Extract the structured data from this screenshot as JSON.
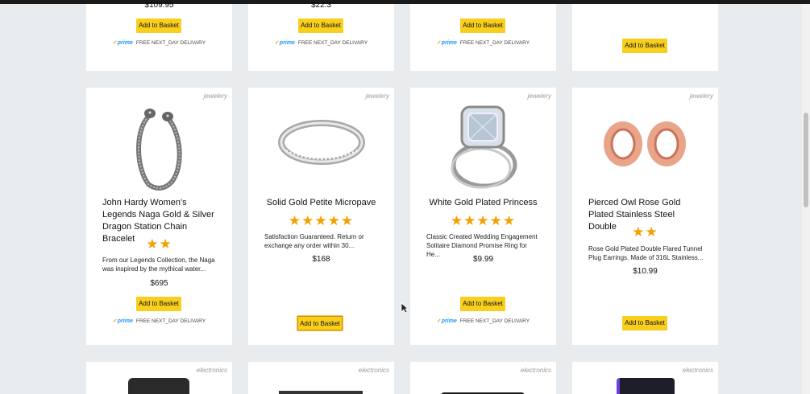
{
  "top_row": [
    {
      "price": "$109.95",
      "button": "Add to Basket",
      "prime": "prime",
      "delivery": "FREE NEXT_DAY DELIVARY"
    },
    {
      "price": "$22.3",
      "button": "Add to Basket",
      "prime": "prime",
      "delivery": "FREE NEXT_DAY DELIVARY"
    },
    {
      "price": "",
      "button": "Add to Basket",
      "prime": "prime",
      "delivery": "FREE NEXT_DAY DELIVARY"
    },
    {
      "price": "",
      "button": "Add to Basket"
    }
  ],
  "products": [
    {
      "category": "jewelery",
      "title": "John Hardy Women's Legends Naga Gold & Silver Dragon Station Chain Bracelet",
      "rating_stars": 2,
      "stars_text": "★★",
      "description": "From our Legends Collection, the Naga was inspired by the mythical water...",
      "price": "$695",
      "button": "Add to Basket",
      "prime": "prime",
      "delivery": "FREE NEXT_DAY DELIVARY"
    },
    {
      "category": "jewelery",
      "title": "Solid Gold Petite Micropave",
      "rating_stars": 5,
      "stars_text": "★★★★★",
      "description": "Satisfaction Guaranteed. Return or exchange any order within 30...",
      "price": "$168",
      "button": "Add to Basket"
    },
    {
      "category": "jewelery",
      "title": "White Gold Plated Princess",
      "rating_stars": 5,
      "stars_text": "★★★★★",
      "description": "Classic Created Wedding Engagement Solitaire Diamond Promise Ring for He...",
      "price": "$9.99",
      "button": "Add to Basket",
      "prime": "prime",
      "delivery": "FREE NEXT_DAY DELIVARY"
    },
    {
      "category": "jewelery",
      "title": "Pierced Owl Rose Gold Plated Stainless Steel Double",
      "rating_stars": 2,
      "stars_text": "★★",
      "description": "Rose Gold Plated Double Flared Tunnel Plug Earrings. Made of 316L Stainless...",
      "price": "$10.99",
      "button": "Add to Basket"
    }
  ],
  "bottom_row": [
    {
      "category": "electronics"
    },
    {
      "category": "electronics"
    },
    {
      "category": "electronics"
    },
    {
      "category": "electronics"
    }
  ],
  "colors": {
    "button": "#f9cf1d",
    "star": "#f5a000",
    "prime": "#1a98ff",
    "background": "#e9ecef"
  }
}
